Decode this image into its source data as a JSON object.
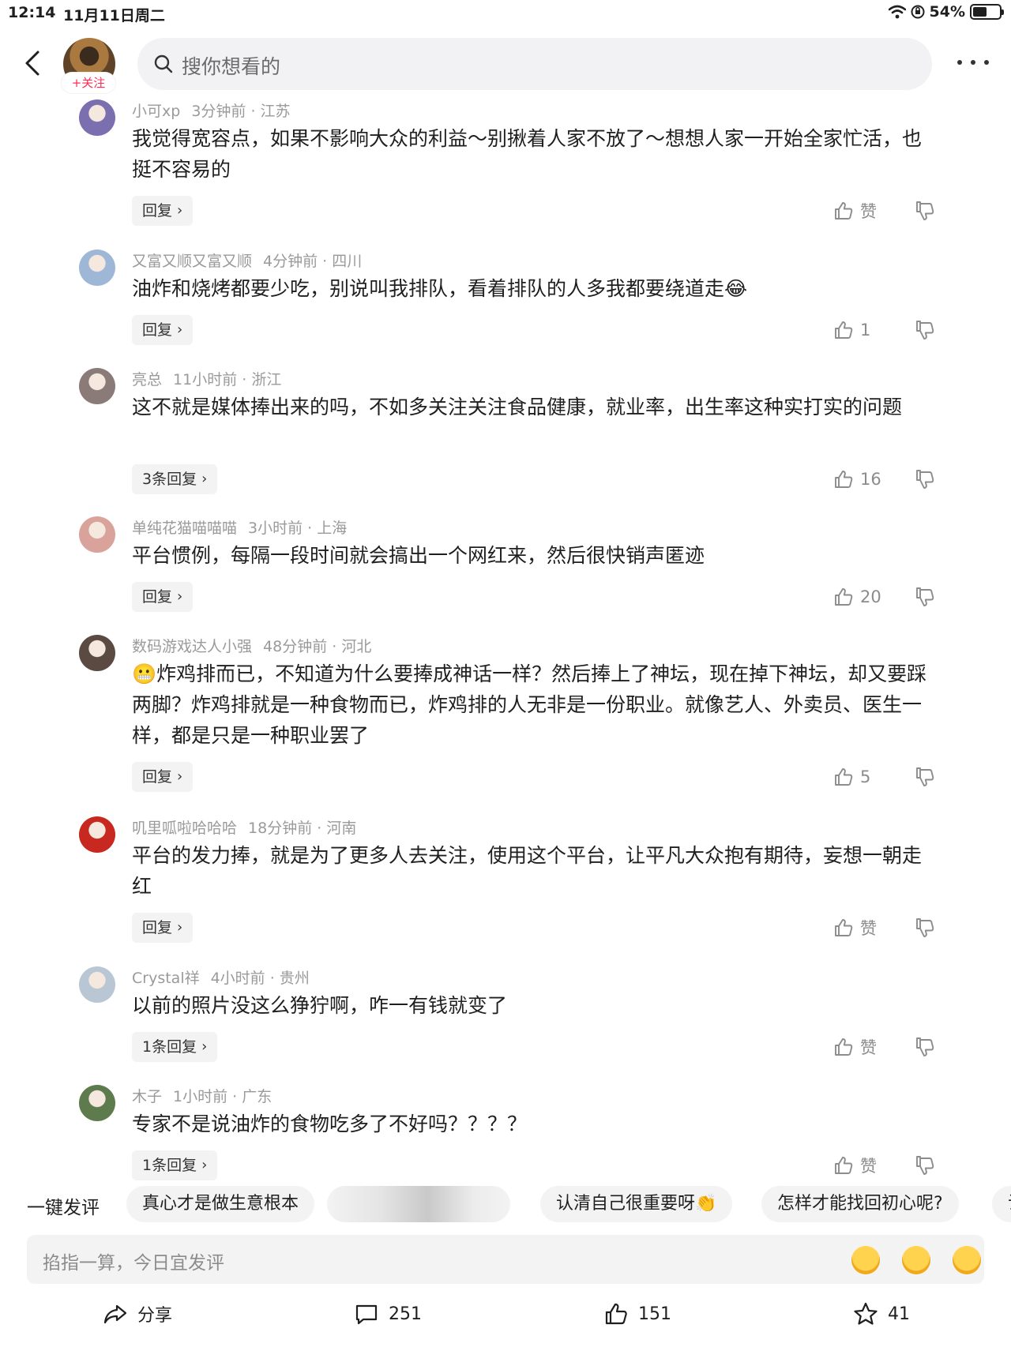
{
  "status_bar": {
    "time": "12:14",
    "date": "11月11日周二",
    "battery": "54%",
    "battery_level": 0.54
  },
  "header": {
    "follow_label": "+关注",
    "search_placeholder": "搜你想看的"
  },
  "comments": [
    {
      "name": "小可xp",
      "time": "3分钟前",
      "location": "江苏",
      "text": "我觉得宽容点，如果不影响大众的利益～别揪着人家不放了～想想人家一开始全家忙活，也挺不容易的",
      "reply_label": "回复",
      "likes": "赞",
      "avatar_color": "#7b6fb0"
    },
    {
      "name": "又富又顺又富又顺",
      "time": "4分钟前",
      "location": "四川",
      "text": "油炸和烧烤都要少吃，别说叫我排队，看着排队的人多我都要绕道走😂",
      "reply_label": "回复",
      "likes": "1",
      "avatar_color": "#9fb7d6"
    },
    {
      "name": "亮总",
      "time": "11小时前",
      "location": "浙江",
      "text": "这不就是媒体捧出来的吗，不如多关注关注食品健康，就业率，出生率这种实打实的问题",
      "reply_label": "3条回复",
      "likes": "16",
      "avatar_color": "#8a7a78"
    },
    {
      "name": "单纯花猫喵喵喵",
      "time": "3小时前",
      "location": "上海",
      "text": "平台惯例，每隔一段时间就会搞出一个网红来，然后很快销声匿迹",
      "reply_label": "回复",
      "likes": "20",
      "avatar_color": "#d9a29a"
    },
    {
      "name": "数码游戏达人小强",
      "time": "48分钟前",
      "location": "河北",
      "text": "😬炸鸡排而已，不知道为什么要捧成神话一样？然后捧上了神坛，现在掉下神坛，却又要踩两脚？炸鸡排就是一种食物而已，炸鸡排的人无非是一份职业。就像艺人、外卖员、医生一样，都是只是一种职业罢了",
      "reply_label": "回复",
      "likes": "5",
      "avatar_color": "#5a4a42"
    },
    {
      "name": "叽里呱啦哈哈哈",
      "time": "18分钟前",
      "location": "河南",
      "text": "平台的发力捧，就是为了更多人去关注，使用这个平台，让平凡大众抱有期待，妄想一朝走红",
      "reply_label": "回复",
      "likes": "赞",
      "avatar_color": "#c7281f"
    },
    {
      "name": "Crystal祥",
      "time": "4小时前",
      "location": "贵州",
      "text": "以前的照片没这么狰狞啊，咋一有钱就变了",
      "reply_label": "1条回复",
      "likes": "赞",
      "avatar_color": "#b9c6d3"
    },
    {
      "name": "木子",
      "time": "1小时前",
      "location": "广东",
      "text": "专家不是说油炸的食物吃多了不好吗？？？？",
      "reply_label": "1条回复",
      "likes": "赞",
      "avatar_color": "#5d7b4c"
    }
  ],
  "quick_reply": {
    "title": "一键发评",
    "chips": [
      "真心才是做生意根本",
      "",
      "认清自己很重要呀👏",
      "怎样才能找回初心呢?",
      "试"
    ]
  },
  "input": {
    "placeholder": "掐指一算，今日宜发评",
    "emojis": [
      "😂",
      "😍",
      "😆"
    ]
  },
  "bottom": {
    "share": "分享",
    "comments": "251",
    "likes": "151",
    "favorites": "41"
  },
  "colors": {
    "accent": "#fe2c55",
    "meta": "#9a9a9a",
    "pill": "#f3f3f4"
  }
}
